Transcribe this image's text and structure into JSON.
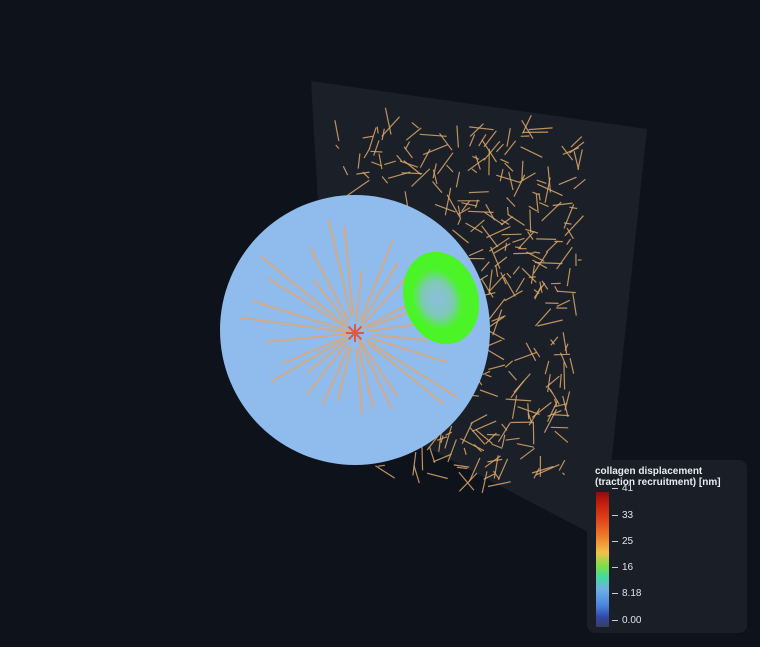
{
  "scene": {
    "background": "#0e121a",
    "plane_color": "#1b1f27",
    "fiber_color": "#d9a86c",
    "cell_color": "#8fbcec",
    "cell_fiber_color": "#e3a56f",
    "cell_center_color": "#e2583c",
    "adhesion_color": "#4bf427"
  },
  "legend": {
    "title": "collagen displacement (traction recruitment) [nm]",
    "ticks": [
      "41",
      "33",
      "25",
      "16",
      "8.18",
      "0.00"
    ]
  }
}
